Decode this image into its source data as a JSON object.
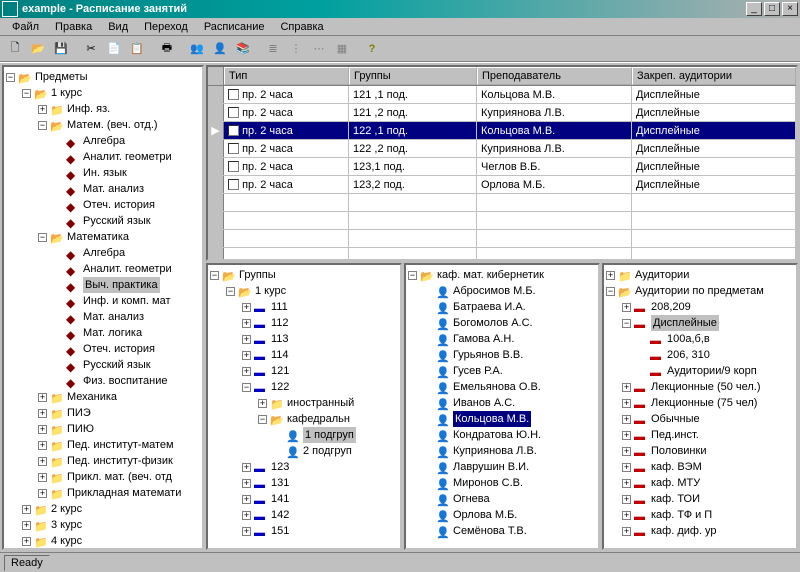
{
  "window": {
    "title": "example - Расписание занятий"
  },
  "menu": [
    "Файл",
    "Правка",
    "Вид",
    "Переход",
    "Расписание",
    "Справка"
  ],
  "status": "Ready",
  "grid": {
    "columns": [
      "Тип",
      "Группы",
      "Преподаватель",
      "Закреп. аудитории"
    ],
    "rows": [
      {
        "type": "пр. 2 часа",
        "group": "121 ,1 под.",
        "teacher": "Кольцова М.В.",
        "room": "Дисплейные",
        "sel": false
      },
      {
        "type": "пр. 2 часа",
        "group": "121 ,2 под.",
        "teacher": "Куприянова Л.В.",
        "room": "Дисплейные",
        "sel": false
      },
      {
        "type": "пр. 2 часа",
        "group": "122 ,1 под.",
        "teacher": "Кольцова М.В.",
        "room": "Дисплейные",
        "sel": true
      },
      {
        "type": "пр. 2 часа",
        "group": "122 ,2 под.",
        "teacher": "Куприянова Л.В.",
        "room": "Дисплейные",
        "sel": false
      },
      {
        "type": "пр. 2 часа",
        "group": "123,1 под.",
        "teacher": "Чеглов В.Б.",
        "room": "Дисплейные",
        "sel": false
      },
      {
        "type": "пр. 2 часа",
        "group": "123,2 под.",
        "teacher": "Орлова М.Б.",
        "room": "Дисплейные",
        "sel": false
      }
    ]
  },
  "tree_subjects": {
    "root": "Предметы",
    "k1": "1 курс",
    "inf": "Инф. яз.",
    "matvech": "Матем. (веч. отд.)",
    "mat_items": [
      "Алгебра",
      "Аналит. геометри",
      "Ин. язык",
      "Мат. анализ",
      "Отеч. история",
      "Русский язык"
    ],
    "matematika": "Математика",
    "math_items": [
      "Алгебра",
      "Аналит. геометри",
      "Выч. практика",
      "Инф. и комп. мат",
      "Мат. анализ",
      "Мат. логика",
      "Отеч. история",
      "Русский язык",
      "Физ. воспитание"
    ],
    "others": [
      "Механика",
      "ПИЭ",
      "ПИЮ",
      "Пед. институт-матем",
      "Пед. институт-физик",
      "Прикл. мат. (веч. отд",
      "Прикладная математи"
    ],
    "k2": "2 курс",
    "k3": "3 курс",
    "k4": "4 курс"
  },
  "tree_groups": {
    "root": "Группы",
    "k1": "1 курс",
    "g": [
      "111",
      "112",
      "113",
      "114",
      "121",
      "122"
    ],
    "s122": [
      "иностранный",
      "кафедральн"
    ],
    "subg": [
      "1 подгруп",
      "2 подгруп"
    ],
    "g2": [
      "123",
      "131",
      "141",
      "142",
      "151"
    ]
  },
  "tree_teachers": {
    "root": "каф. мат. кибернетик",
    "list": [
      "Абросимов М.Б.",
      "Батраева И.А.",
      "Богомолов А.С.",
      "Гамова А.Н.",
      "Гурьянов В.В.",
      "Гусев Р.А.",
      "Емельянова О.В.",
      "Иванов А.С.",
      "Кольцова М.В.",
      "Кондратова Ю.Н.",
      "Куприянова Л.В.",
      "Лаврушин В.И.",
      "Миронов С.В.",
      "Огнева",
      "Орлова М.Б.",
      "Семёнова Т.В."
    ],
    "selected": "Кольцова М.В."
  },
  "tree_rooms": {
    "root": "Аудитории",
    "bysubj": "Аудитории по предметам",
    "a1": "208,209",
    "disp": "Дисплейные",
    "disp_sub": [
      "100а,б,в",
      "206, 310",
      "Аудитории/9 корп"
    ],
    "rest": [
      "Лекционные (50 чел.)",
      "Лекционные (75 чел)",
      "Обычные",
      "Пед.инст.",
      "Половинки",
      "каф. ВЭМ",
      "каф. МТУ",
      "каф. ТОИ",
      "каф. ТФ и П",
      "каф. диф. ур"
    ]
  }
}
